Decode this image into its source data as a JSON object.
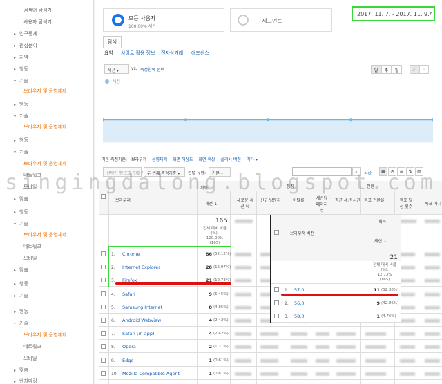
{
  "sidebar": {
    "items": [
      {
        "label": "검색어 탐색기"
      },
      {
        "label": "사용자 탐색기"
      },
      {
        "label": "인구통계"
      },
      {
        "label": "관심분야"
      },
      {
        "label": "지역"
      },
      {
        "label": "행동"
      },
      {
        "label": "기술"
      },
      {
        "label": "브라우저 및 운영체제"
      },
      {
        "label": "행동"
      },
      {
        "label": "기술"
      },
      {
        "label": "브라우저 및 운영체제"
      },
      {
        "label": "행동"
      },
      {
        "label": "기술"
      },
      {
        "label": "브라우저 및 운영체제"
      },
      {
        "label": "네트워크"
      },
      {
        "label": "모바일"
      },
      {
        "label": "맞춤"
      },
      {
        "label": "행동"
      },
      {
        "label": "기술"
      },
      {
        "label": "브라우저 및 운영체제"
      },
      {
        "label": "네트워크"
      },
      {
        "label": "모바일"
      },
      {
        "label": "맞춤"
      },
      {
        "label": "행동"
      },
      {
        "label": "기술"
      },
      {
        "label": "행동"
      },
      {
        "label": "기술"
      },
      {
        "label": "브라우저 및 운영체제"
      },
      {
        "label": "네트워크"
      },
      {
        "label": "모바일"
      },
      {
        "label": "맞춤"
      },
      {
        "label": "벤치마킹"
      }
    ]
  },
  "segments": {
    "all_users": {
      "name": "모든 사용자",
      "sub": "100.00% 세션"
    },
    "add": {
      "name": "+ 세그먼트"
    }
  },
  "date_range": "2017. 11. 7. - 2017. 11. 9.",
  "tabs": {
    "explore": "탐색",
    "sub": [
      "요약",
      "사이트 활용 정보",
      "전자상거래",
      "애드센스"
    ]
  },
  "controls": {
    "metric_select": "세션",
    "vs": "vs.",
    "select_metric": "측정항목 선택",
    "period_buttons": [
      "일",
      "주",
      "월"
    ]
  },
  "chart_data": {
    "type": "line",
    "series": [
      {
        "name": "세션",
        "values": [
          70,
          70,
          70,
          70,
          70
        ]
      }
    ],
    "ylim": [
      0,
      100
    ]
  },
  "chart_legend": "세션",
  "primary_dims": {
    "label": "기본 측정기준:",
    "items": [
      "브라우저",
      "운영체제",
      "화면 해상도",
      "화면 색상",
      "플래시 버전",
      "기타 ▾"
    ]
  },
  "toolbar": {
    "plot_rows": "선택한 행 도표 만들기",
    "secondary": "두 번째 측정기준 ▾",
    "sort_type": "정렬 유형:",
    "sort_value": "기본 ▾",
    "advanced": "고급"
  },
  "watermark": "singingdalong.blogspot.com",
  "table": {
    "headers": {
      "browser": "브라우저",
      "acquisition": "획득",
      "behavior": "동작",
      "conversion": "전환",
      "sessions": "세션",
      "new_sessions": "새로운 세션 %",
      "new_users": "신규 방문자",
      "bounce": "이탈률",
      "pages": "세션당 페이지수",
      "duration": "평균 세션 시간",
      "goal_rate": "목표 전환율",
      "goal_completions": "목표 달성 횟수",
      "goal_value": "목표 가치"
    },
    "totals": {
      "sessions": "165",
      "sessions_sub1": "전체 대비 비율(%):",
      "sessions_sub2": "100.00%",
      "sessions_sub3": "(165)"
    },
    "rows": [
      {
        "n": "1.",
        "name": "Chrome",
        "sessions": "86",
        "pct": "(52.12%)"
      },
      {
        "n": "2.",
        "name": "Internet Explorer",
        "sessions": "28",
        "pct": "(16.97%)"
      },
      {
        "n": "3.",
        "name": "Firefox",
        "sessions": "21",
        "pct": "(12.73%)"
      },
      {
        "n": "4.",
        "name": "Safari",
        "sessions": "9",
        "pct": "(5.45%)"
      },
      {
        "n": "5.",
        "name": "Samsung Internet",
        "sessions": "8",
        "pct": "(4.85%)"
      },
      {
        "n": "6.",
        "name": "Android Webview",
        "sessions": "4",
        "pct": "(2.42%)"
      },
      {
        "n": "7.",
        "name": "Safari (in-app)",
        "sessions": "4",
        "pct": "(2.42%)"
      },
      {
        "n": "8.",
        "name": "Opera",
        "sessions": "2",
        "pct": "(1.21%)"
      },
      {
        "n": "9.",
        "name": "Edge",
        "sessions": "1",
        "pct": "(0.61%)"
      },
      {
        "n": "10.",
        "name": "Mozilla Compatible Agent",
        "sessions": "1",
        "pct": "(0.61%)"
      }
    ]
  },
  "overlay": {
    "acquisition": "획득",
    "version_header": "브라우저 버전",
    "sessions": "세션",
    "total": "21",
    "total_sub1": "전체 대비 비율",
    "total_sub2": "(%):",
    "total_sub3": "12.73%",
    "total_sub4": "(165)",
    "rows": [
      {
        "n": "1.",
        "version": "57.0",
        "sessions": "11",
        "pct": "(52.38%)"
      },
      {
        "n": "2.",
        "version": "56.0",
        "sessions": "9",
        "pct": "(42.86%)"
      },
      {
        "n": "3.",
        "version": "58.0",
        "sessions": "1",
        "pct": "(4.76%)"
      }
    ]
  }
}
